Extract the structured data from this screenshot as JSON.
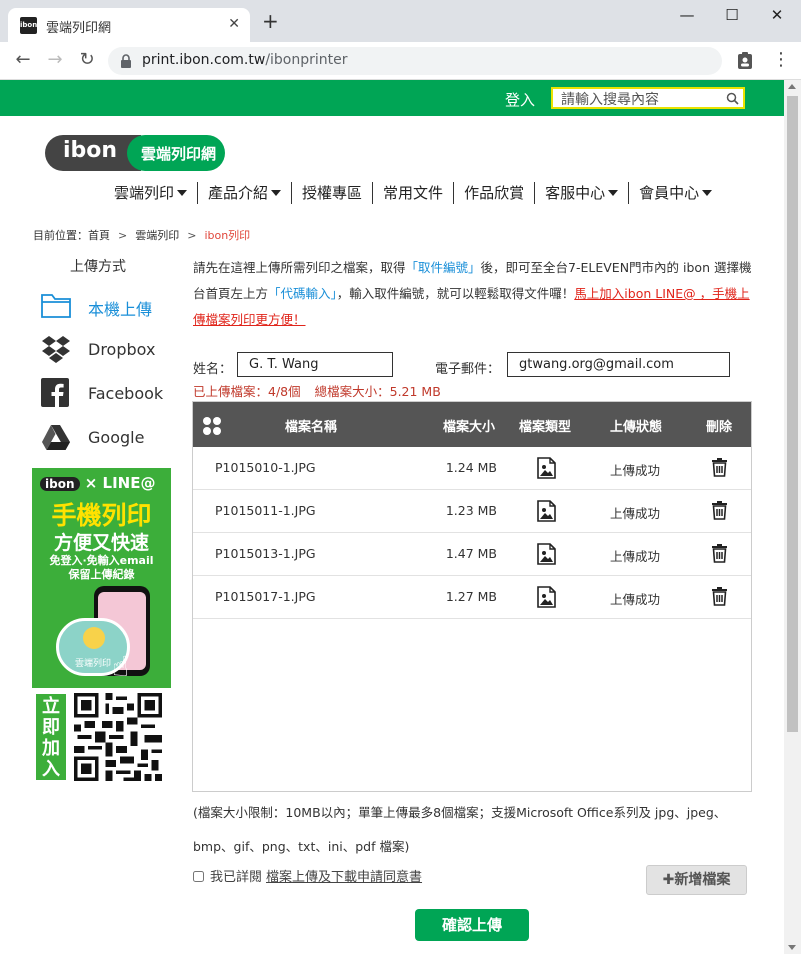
{
  "browser": {
    "tab_title": "雲端列印網",
    "favicon_text": "ibon",
    "url_host": "print.ibon.com.tw",
    "url_path": "/ibonprinter"
  },
  "header": {
    "login_label": "登入",
    "search_placeholder": "請輸入搜尋內容",
    "logo_ibon": "ibon",
    "logo_cn": "雲端列印網"
  },
  "nav": {
    "items": [
      {
        "label": "雲端列印",
        "has_caret": true
      },
      {
        "label": "產品介紹",
        "has_caret": true
      },
      {
        "label": "授權專區",
        "has_caret": false
      },
      {
        "label": "常用文件",
        "has_caret": false
      },
      {
        "label": "作品欣賞",
        "has_caret": false
      },
      {
        "label": "客服中心",
        "has_caret": true
      },
      {
        "label": "會員中心",
        "has_caret": true
      }
    ]
  },
  "breadcrumb": {
    "prefix": "目前位置：首頁",
    "sep": ">",
    "level2": "雲端列印",
    "current": "ibon列印"
  },
  "sidebar": {
    "title": "上傳方式",
    "items": [
      {
        "label": "本機上傳",
        "icon": "folder-icon"
      },
      {
        "label": "Dropbox",
        "icon": "dropbox-icon"
      },
      {
        "label": "Facebook",
        "icon": "facebook-icon"
      },
      {
        "label": "Google",
        "icon": "google-drive-icon"
      }
    ]
  },
  "ad": {
    "top_ibon": "ibon",
    "top_rest": "× LINE@",
    "headline": "手機列印",
    "subhead": "方便又快速",
    "line3": "免登入·免輸入email",
    "line4": "保留上傳紀錄",
    "cloud_text": "雲端列印",
    "join_text": "立即加入"
  },
  "intro": {
    "p1": "請先在這裡上傳所需列印之檔案，取得",
    "kw1": "「取件編號」",
    "p2": "後，即可至全台7-ELEVEN門市內的 ibon 選擇機台首頁左上方",
    "kw2": "「代碼輸入」",
    "p3": "，輸入取件編號，就可以輕鬆取得文件囉！",
    "red_link": "馬上加入ibon LINE@ ，手機上傳檔案列印更方便！"
  },
  "form": {
    "name_label": "姓名：",
    "name_value": "G. T. Wang",
    "email_label": "電子郵件：",
    "email_value": "gtwang.org@gmail.com"
  },
  "status": {
    "uploaded": "已上傳檔案：4/8個",
    "total": "總檔案大小：5.21 MB"
  },
  "table": {
    "headers": {
      "name": "檔案名稱",
      "size": "檔案大小",
      "type": "檔案類型",
      "status": "上傳狀態",
      "delete": "刪除"
    },
    "rows": [
      {
        "name": "P1015010-1.JPG",
        "size": "1.24 MB",
        "status": "上傳成功"
      },
      {
        "name": "P1015011-1.JPG",
        "size": "1.23 MB",
        "status": "上傳成功"
      },
      {
        "name": "P1015013-1.JPG",
        "size": "1.47 MB",
        "status": "上傳成功"
      },
      {
        "name": "P1015017-1.JPG",
        "size": "1.27 MB",
        "status": "上傳成功"
      }
    ]
  },
  "note": {
    "text": "(檔案大小限制：10MB以內；單筆上傳最多8個檔案；支援Microsoft Office系列及 jpg、jpeg、bmp、gif、png、txt、ini、pdf 檔案)"
  },
  "footer": {
    "agree_prefix": "我已詳閱",
    "agree_link": "檔案上傳及下載申請同意書",
    "add_file_label": "新增檔案",
    "confirm_label": "確認上傳"
  },
  "colors": {
    "brand_green": "#00a555",
    "link_blue": "#1a8fd8",
    "alert_red": "#e0251b",
    "table_header": "#555555"
  }
}
